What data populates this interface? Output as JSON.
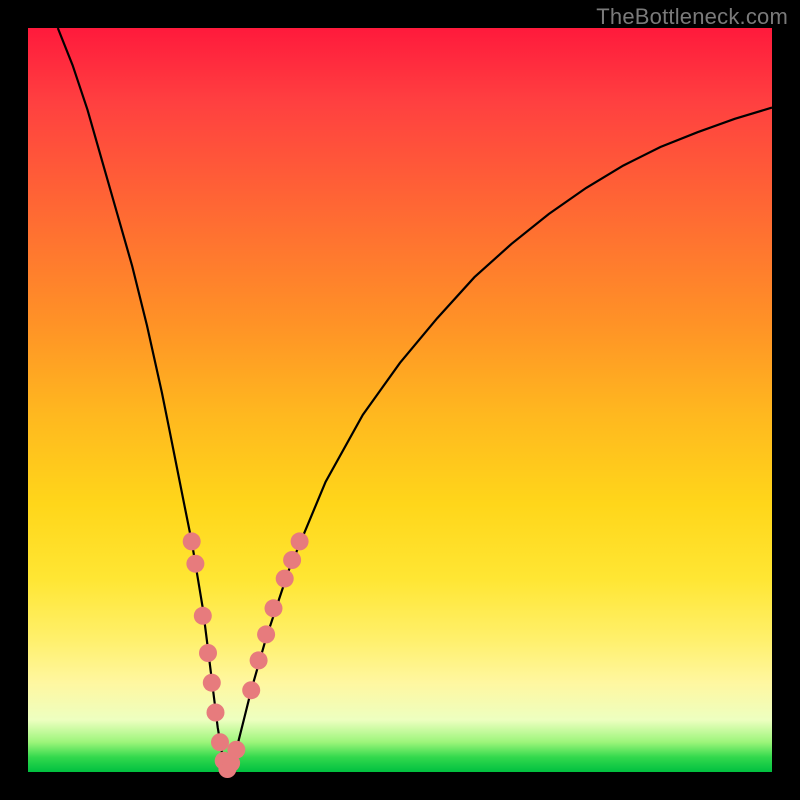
{
  "watermark": {
    "text": "TheBottleneck.com"
  },
  "colors": {
    "frame": "#000000",
    "curve": "#000000",
    "dot": "#e77b7d",
    "gradient_stops": [
      "#ff1a3c",
      "#ff4040",
      "#ff6a33",
      "#ff9326",
      "#ffb81f",
      "#ffd61a",
      "#ffe633",
      "#fff06a",
      "#fff7a0",
      "#edffc0",
      "#9cf57a",
      "#33d94d",
      "#00c040"
    ]
  },
  "chart_data": {
    "type": "line",
    "title": "",
    "xlabel": "",
    "ylabel": "",
    "xlim": [
      0,
      100
    ],
    "ylim": [
      0,
      100
    ],
    "grid": false,
    "legend": false,
    "series": [
      {
        "name": "bottleneck-curve",
        "x": [
          4,
          6,
          8,
          10,
          12,
          14,
          16,
          18,
          19,
          20,
          21,
          22,
          23,
          23.5,
          24,
          24.5,
          25,
          25.5,
          26,
          26.3,
          26.6,
          27,
          27.5,
          28,
          29,
          30,
          32,
          35,
          40,
          45,
          50,
          55,
          60,
          65,
          70,
          75,
          80,
          85,
          90,
          95,
          100
        ],
        "values": [
          100,
          95,
          89,
          82,
          75,
          68,
          60,
          51,
          46,
          41,
          36,
          31,
          25,
          22,
          18,
          14,
          10,
          6,
          3,
          1.5,
          0.5,
          0.5,
          1.5,
          3,
          7,
          11,
          18,
          27,
          39,
          48,
          55,
          61,
          66.5,
          71,
          75,
          78.5,
          81.5,
          84,
          86,
          87.8,
          89.3
        ]
      }
    ],
    "markers": [
      {
        "name": "highlighted-dots",
        "points": [
          {
            "x": 22.0,
            "y": 31
          },
          {
            "x": 22.5,
            "y": 28
          },
          {
            "x": 23.5,
            "y": 21
          },
          {
            "x": 24.2,
            "y": 16
          },
          {
            "x": 24.7,
            "y": 12
          },
          {
            "x": 25.2,
            "y": 8
          },
          {
            "x": 25.8,
            "y": 4
          },
          {
            "x": 26.3,
            "y": 1.5
          },
          {
            "x": 26.8,
            "y": 0.4
          },
          {
            "x": 27.3,
            "y": 1.2
          },
          {
            "x": 28.0,
            "y": 3
          },
          {
            "x": 30.0,
            "y": 11
          },
          {
            "x": 31.0,
            "y": 15
          },
          {
            "x": 32.0,
            "y": 18.5
          },
          {
            "x": 33.0,
            "y": 22
          },
          {
            "x": 34.5,
            "y": 26
          },
          {
            "x": 35.5,
            "y": 28.5
          },
          {
            "x": 36.5,
            "y": 31
          }
        ]
      }
    ]
  }
}
